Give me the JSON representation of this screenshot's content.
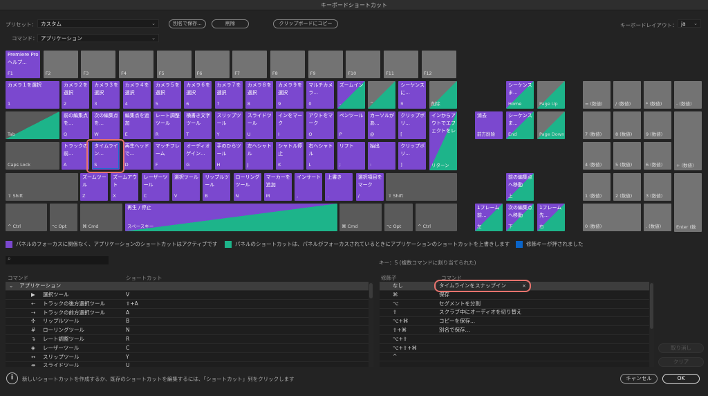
{
  "window": {
    "title": "キーボードショートカット"
  },
  "toolbar": {
    "preset_label": "プリセット：",
    "preset_value": "カスタム",
    "command_label": "コマンド：",
    "command_value": "アプリケーション",
    "save_as": "別名で保存...",
    "delete": "削除",
    "copy_clipboard": "クリップボードにコピー",
    "layout_label": "キーボードレイアウト：",
    "layout_value": "ja"
  },
  "colors": {
    "app": "#7b48cf",
    "panel": "#1db48a",
    "modifier": "#0a64c8",
    "unassigned": "#737373"
  },
  "keyboard": {
    "rows": [
      [
        {
          "cmd": "Premiere Pro ヘルプ...",
          "key": "F1",
          "t": "app"
        },
        {
          "cmd": "",
          "key": "F2",
          "t": "none"
        },
        {
          "cmd": "",
          "key": "F3",
          "t": "none"
        },
        {
          "cmd": "",
          "key": "F4",
          "t": "none"
        },
        {
          "cmd": "",
          "key": "F5",
          "t": "none"
        },
        {
          "cmd": "",
          "key": "F6",
          "t": "none"
        },
        {
          "cmd": "",
          "key": "F7",
          "t": "none"
        },
        {
          "cmd": "",
          "key": "F8",
          "t": "none"
        },
        {
          "cmd": "",
          "key": "F9",
          "t": "none"
        },
        {
          "cmd": "",
          "key": "F10",
          "t": "none"
        },
        {
          "cmd": "",
          "key": "F11",
          "t": "none"
        },
        {
          "cmd": "",
          "key": "F12",
          "t": "none"
        }
      ],
      [
        {
          "cmd": "カメラ１を選択",
          "key": "1",
          "t": "app"
        },
        {
          "cmd": "カメラ２を選択",
          "key": "2",
          "t": "app"
        },
        {
          "cmd": "カメラ３を選択",
          "key": "3",
          "t": "app"
        },
        {
          "cmd": "カメラ４を選択",
          "key": "4",
          "t": "app"
        },
        {
          "cmd": "カメラ５を選択",
          "key": "5",
          "t": "app"
        },
        {
          "cmd": "カメラ６を選択",
          "key": "6",
          "t": "app"
        },
        {
          "cmd": "カメラ７を選択",
          "key": "7",
          "t": "app"
        },
        {
          "cmd": "カメラ８を選択",
          "key": "8",
          "t": "app"
        },
        {
          "cmd": "カメラ９を選択",
          "key": "9",
          "t": "app"
        },
        {
          "cmd": "マルチカメラ...",
          "key": "0",
          "t": "app"
        },
        {
          "cmd": "ズームイン",
          "key": "-",
          "t": "split"
        },
        {
          "cmd": "",
          "key": "^",
          "t": "gsplit"
        },
        {
          "cmd": "シーケンスに...",
          "key": "¥",
          "t": "app"
        },
        {
          "cmd": "",
          "key": "削除",
          "t": "gsplit"
        }
      ],
      [
        {
          "cmd": "",
          "key": "Tab",
          "t": "dsplit"
        },
        {
          "cmd": "前の編集点を...",
          "key": "Q",
          "t": "app"
        },
        {
          "cmd": "次の編集点を...",
          "key": "W",
          "t": "app"
        },
        {
          "cmd": "編集点を追加",
          "key": "E",
          "t": "app"
        },
        {
          "cmd": "レート調整ツール",
          "key": "R",
          "t": "app"
        },
        {
          "cmd": "横書き文字ツール",
          "key": "T",
          "t": "app"
        },
        {
          "cmd": "スリップツール",
          "key": "Y",
          "t": "app"
        },
        {
          "cmd": "スライドツール",
          "key": "U",
          "t": "app"
        },
        {
          "cmd": "インをマーク",
          "key": "I",
          "t": "app"
        },
        {
          "cmd": "アウトをマーク",
          "key": "O",
          "t": "app"
        },
        {
          "cmd": "ペンツール",
          "key": "P",
          "t": "app"
        },
        {
          "cmd": "カーソルがあ...",
          "key": "@",
          "t": "app"
        },
        {
          "cmd": "クリップボリ...",
          "key": "[",
          "t": "app"
        },
        {
          "cmd": "インからアウトでエフェクトをレンダリング",
          "key": "リターン",
          "t": "split"
        }
      ],
      [
        {
          "cmd": "",
          "key": "Caps Lock",
          "t": "dark"
        },
        {
          "cmd": "トラックの前...",
          "key": "A",
          "t": "app"
        },
        {
          "cmd": "タイムライン...",
          "key": "S",
          "t": "app"
        },
        {
          "cmd": "再生ヘッドで...",
          "key": "D",
          "t": "app"
        },
        {
          "cmd": "マッチフレーム",
          "key": "F",
          "t": "app"
        },
        {
          "cmd": "オーディオゲイン...",
          "key": "G",
          "t": "app"
        },
        {
          "cmd": "手のひらツール",
          "key": "H",
          "t": "app"
        },
        {
          "cmd": "左へシャトル",
          "key": "J",
          "t": "app"
        },
        {
          "cmd": "シャトル停止",
          "key": "K",
          "t": "app"
        },
        {
          "cmd": "右へシャトル",
          "key": "L",
          "t": "app"
        },
        {
          "cmd": "リフト",
          "key": ";",
          "t": "app"
        },
        {
          "cmd": "抽出",
          "key": ":",
          "t": "app"
        },
        {
          "cmd": "クリップボリ...",
          "key": "]",
          "t": "app"
        }
      ],
      [
        {
          "cmd": "",
          "key": "⇧ Shift",
          "t": "dark"
        },
        {
          "cmd": "ズームツール",
          "key": "Z",
          "t": "app"
        },
        {
          "cmd": "ズームアウト",
          "key": "X",
          "t": "app"
        },
        {
          "cmd": "レーザーツール",
          "key": "C",
          "t": "app"
        },
        {
          "cmd": "選択ツール",
          "key": "V",
          "t": "app"
        },
        {
          "cmd": "リップルツール",
          "key": "B",
          "t": "app"
        },
        {
          "cmd": "ローリングツール",
          "key": "N",
          "t": "app"
        },
        {
          "cmd": "マーカーを追加",
          "key": "M",
          "t": "app"
        },
        {
          "cmd": "インサート",
          "key": ",",
          "t": "app"
        },
        {
          "cmd": "上書き",
          "key": ".",
          "t": "app"
        },
        {
          "cmd": "選択項目をマーク",
          "key": "/",
          "t": "app"
        },
        {
          "cmd": "",
          "key": "⇧ Shift",
          "t": "dark"
        }
      ],
      [
        {
          "cmd": "",
          "key": "^ Ctrl",
          "t": "dark"
        },
        {
          "cmd": "",
          "key": "⌥ Opt",
          "t": "dark"
        },
        {
          "cmd": "",
          "key": "⌘ Cmd",
          "t": "dark"
        },
        {
          "cmd": "再生 / 停止",
          "key": "スペースキー",
          "t": "wedge"
        },
        {
          "cmd": "",
          "key": "⌘ Cmd",
          "t": "dark"
        },
        {
          "cmd": "",
          "key": "⌥ Opt",
          "t": "dark"
        },
        {
          "cmd": "",
          "key": "^ Ctrl",
          "t": "dark"
        }
      ]
    ],
    "selected_key": "S",
    "nav": [
      {
        "cmd": "シーケンスま...",
        "key": "Home",
        "t": "split"
      },
      {
        "cmd": "",
        "key": "Page Up",
        "t": "gsplit"
      },
      {
        "cmd": "消去",
        "key": "前方削除",
        "t": "app"
      },
      {
        "cmd": "シーケンスま...",
        "key": "End",
        "t": "split"
      },
      {
        "cmd": "",
        "key": "Page Down",
        "t": "gsplit"
      },
      {
        "cmd": "前の編集点へ移動",
        "key": "上",
        "t": "split"
      },
      {
        "cmd": "1フレーム前...",
        "key": "左",
        "t": "split"
      },
      {
        "cmd": "次の編集点へ移動",
        "key": "下",
        "t": "split"
      },
      {
        "cmd": "1フレーム先...",
        "key": "右",
        "t": "split"
      }
    ],
    "numpad": [
      {
        "cmd": "",
        "key": "= (数値)",
        "t": "none"
      },
      {
        "cmd": "",
        "key": "/ (数値)",
        "t": "none"
      },
      {
        "cmd": "",
        "key": "* (数値)",
        "t": "none"
      },
      {
        "cmd": "",
        "key": "- (数値)",
        "t": "none"
      },
      {
        "cmd": "",
        "key": "7 (数値)",
        "t": "none"
      },
      {
        "cmd": "",
        "key": "8 (数値)",
        "t": "none"
      },
      {
        "cmd": "",
        "key": "9 (数値)",
        "t": "none"
      },
      {
        "cmd": "",
        "key": "+ (数値)",
        "t": "none"
      },
      {
        "cmd": "",
        "key": "4 (数値)",
        "t": "none"
      },
      {
        "cmd": "",
        "key": "5 (数値)",
        "t": "none"
      },
      {
        "cmd": "",
        "key": "6 (数値)",
        "t": "none"
      },
      {
        "cmd": "",
        "key": "1 (数値)",
        "t": "none"
      },
      {
        "cmd": "",
        "key": "2 (数値)",
        "t": "none"
      },
      {
        "cmd": "",
        "key": "3 (数値)",
        "t": "none"
      },
      {
        "cmd": "",
        "key": "Enter (数",
        "t": "none"
      },
      {
        "cmd": "",
        "key": "0 (数値)",
        "t": "none"
      },
      {
        "cmd": "",
        "key": ". (数値)",
        "t": "none"
      }
    ]
  },
  "legend": {
    "app": "パネルのフォーカスに関係なく、アプリケーションのショートカットはアクティブです",
    "panel": "パネルのショートカットは、パネルがフォーカスされているときにアプリケーションのショートカットを上書きします",
    "modifier": "修飾キーが押されました"
  },
  "search": {
    "placeholder": ""
  },
  "commands_table": {
    "headers": [
      "コマンド",
      "ショートカット"
    ],
    "group": "アプリケーション",
    "rows": [
      {
        "icon": "▶",
        "name": "選択ツール",
        "shortcut": "V"
      },
      {
        "icon": "⇠",
        "name": "トラックの後方選択ツール",
        "shortcut": "⇧+A"
      },
      {
        "icon": "⇢",
        "name": "トラックの前方選択ツール",
        "shortcut": "A"
      },
      {
        "icon": "✣",
        "name": "リップルツール",
        "shortcut": "B"
      },
      {
        "icon": "#",
        "name": "ローリングツール",
        "shortcut": "N"
      },
      {
        "icon": "↴",
        "name": "レート調整ツール",
        "shortcut": "R"
      },
      {
        "icon": "◈",
        "name": "レーザーツール",
        "shortcut": "C"
      },
      {
        "icon": "↔",
        "name": "スリップツール",
        "shortcut": "Y"
      },
      {
        "icon": "⇹",
        "name": "スライドツール",
        "shortcut": "U"
      }
    ]
  },
  "key_info": "キー：S (複数コマンドに割り当てられた)",
  "modifier_table": {
    "headers": [
      "修飾子",
      "コマンド"
    ],
    "rows": [
      {
        "mod": "なし",
        "cmd": "タイムラインをスナップイン"
      },
      {
        "mod": "⌘",
        "cmd": "保存"
      },
      {
        "mod": "⌥",
        "cmd": "セグメントを分割"
      },
      {
        "mod": "⇧",
        "cmd": "スクラブ中にオーディオを切り替え"
      },
      {
        "mod": "⌥+⌘",
        "cmd": "コピーを保存..."
      },
      {
        "mod": "⇧+⌘",
        "cmd": "別名で保存..."
      },
      {
        "mod": "⌥+⇧",
        "cmd": ""
      },
      {
        "mod": "⌥+⇧+⌘",
        "cmd": ""
      },
      {
        "mod": "^",
        "cmd": ""
      }
    ],
    "clear_x": "×"
  },
  "side_buttons": {
    "undo": "取り消し",
    "clear": "クリア"
  },
  "footer": {
    "info": "新しいショートカットを作成するか、既存のショートカットを編集するには、「ショートカット」列をクリックします",
    "cancel": "キャンセル",
    "ok": "OK"
  }
}
